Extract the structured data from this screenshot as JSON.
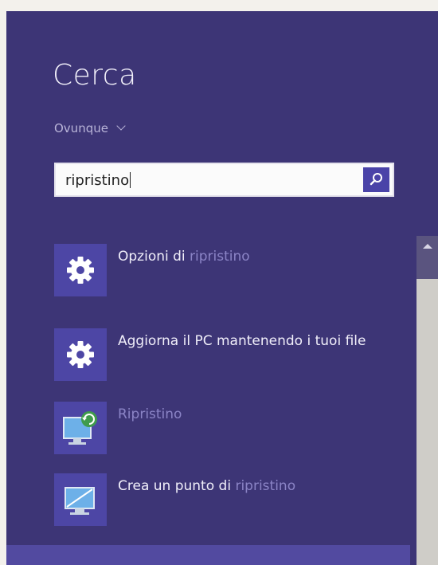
{
  "search_pane": {
    "title": "Cerca",
    "scope_label": "Ovunque",
    "query": "ripristino",
    "search_button_icon": "search-icon",
    "results": [
      {
        "icon": "gear-icon",
        "text": "Opzioni di ",
        "highlight": "ripristino"
      },
      {
        "icon": "gear-icon",
        "text": "Aggiorna il PC mantenendo i tuoi file",
        "highlight": ""
      },
      {
        "icon": "system-restore-icon",
        "text": "Ripristino",
        "highlight": ""
      },
      {
        "icon": "restore-point-icon",
        "text": "Crea un punto di ",
        "highlight": "ripristino"
      }
    ]
  },
  "colors": {
    "panel_background": "#3d3576",
    "accent": "#4d46a5",
    "highlight_text": "#8b84c6"
  }
}
